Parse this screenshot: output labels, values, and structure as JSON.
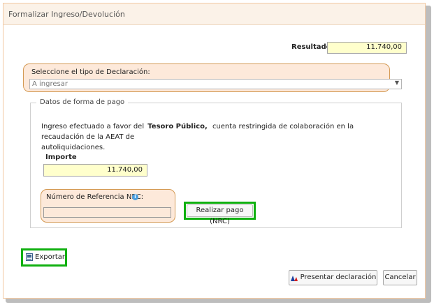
{
  "dialog": {
    "title": "Formalizar Ingreso/Devolución"
  },
  "resultado": {
    "label": "Resultado",
    "value": "11.740,00"
  },
  "declaracion": {
    "label": "Seleccione el tipo de Declaración:",
    "selected": "A ingresar"
  },
  "pago": {
    "legend": "Datos de forma de pago",
    "desc_prefix": "Ingreso efectuado a favor del",
    "desc_bold": "Tesoro Público,",
    "desc_line1_rest": "cuenta restringida de colaboración en la recaudación de la AEAT de",
    "desc_line2": "autoliquidaciones.",
    "importe_label": "Importe",
    "importe_value": "11.740,00",
    "nrc_label": "Número de Referencia NRC:",
    "nrc_value": "",
    "realizar_pago_label": "Realizar pago (NRC)"
  },
  "buttons": {
    "exportar": "Exportar",
    "presentar": "Presentar declaración",
    "cancelar": "Cancelar"
  }
}
